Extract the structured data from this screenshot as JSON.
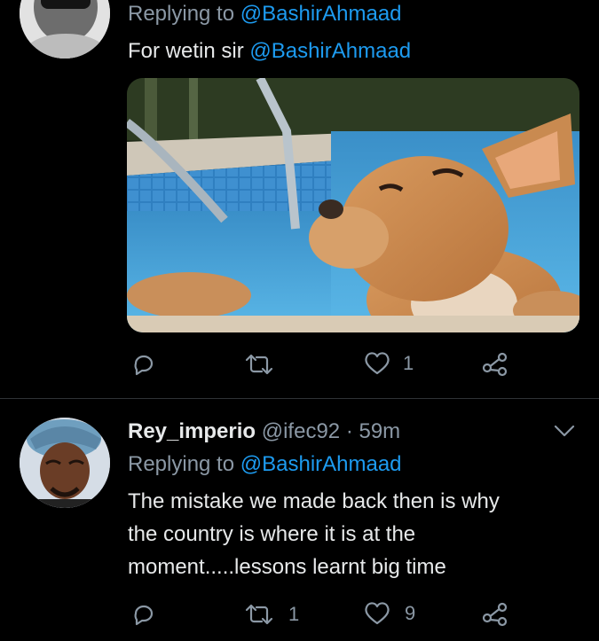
{
  "tweet1": {
    "replying_prefix": "Replying to",
    "replying_handle": "@BashirAhmaad",
    "text_prefix": "For wetin sir",
    "text_mention": "@BashirAhmaad",
    "counts": {
      "reply": "",
      "retweet": "",
      "like": "1"
    }
  },
  "tweet2": {
    "display_name": "Rey_imperio",
    "handle": "@ifec92",
    "separator": "·",
    "time": "59m",
    "replying_prefix": "Replying to",
    "replying_handle": "@BashirAhmaad",
    "text_lines": [
      "The mistake we made back then is why",
      "the country is where it is at the",
      "moment.....lessons learnt big time"
    ],
    "counts": {
      "reply": "",
      "retweet": "1",
      "like": "9"
    }
  },
  "colors": {
    "background": "#000000",
    "text": "#d9d9d9",
    "muted": "#8b98a5",
    "link": "#1d9bf0"
  }
}
